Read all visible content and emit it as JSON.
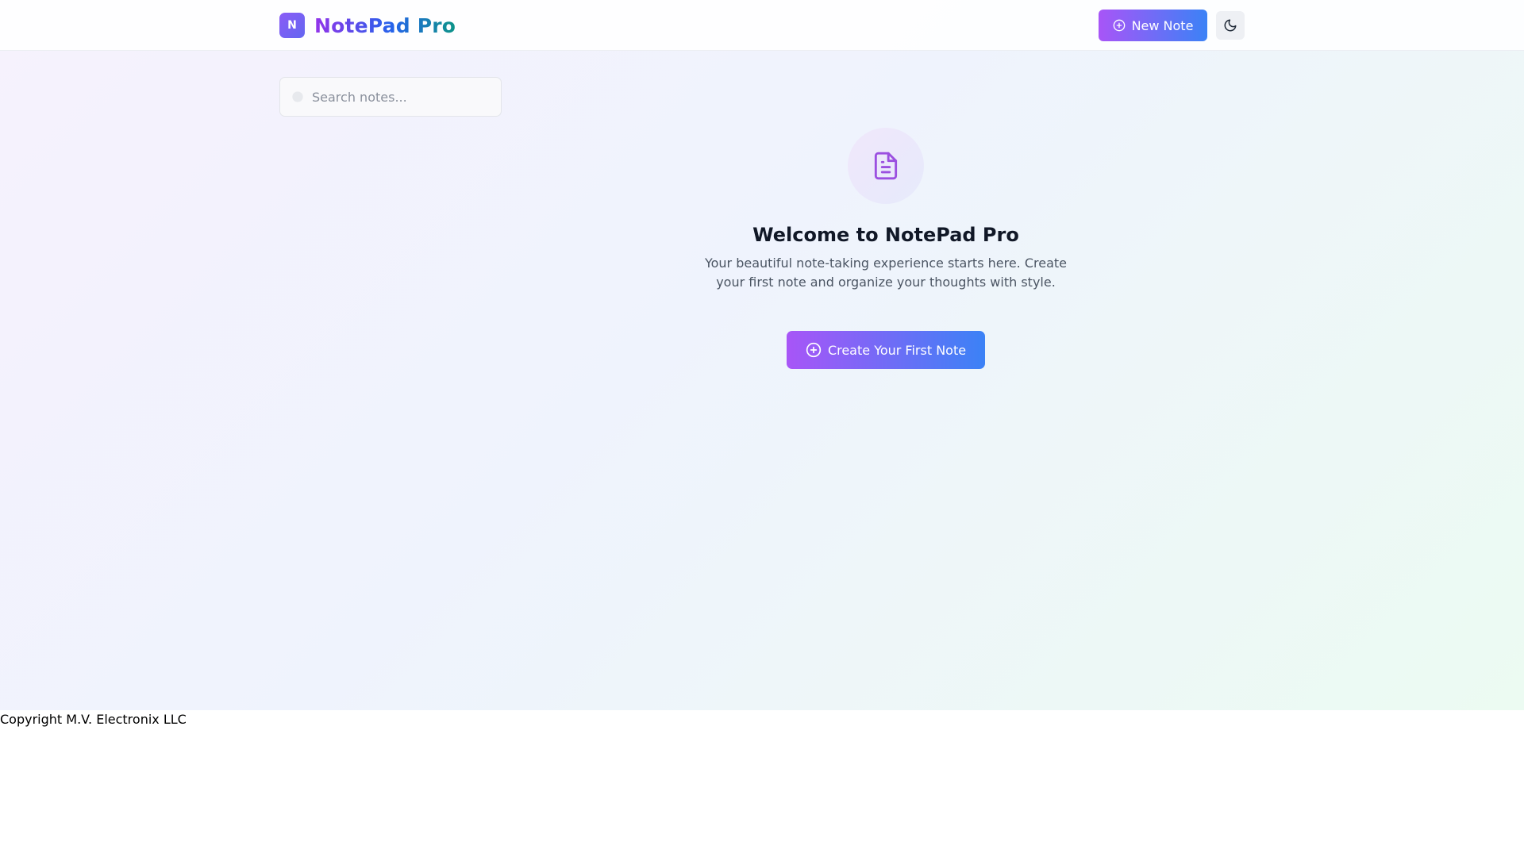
{
  "header": {
    "logo_letter": "N",
    "app_name": "NotePad Pro",
    "new_note_label": "New Note",
    "new_note_icon": "plus-circle-icon",
    "theme_toggle_icon": "moon-icon"
  },
  "search": {
    "placeholder": "Search notes...",
    "value": "",
    "icon": "search-icon"
  },
  "empty_state": {
    "icon": "file-text-icon",
    "title": "Welcome to NotePad Pro",
    "description": "Your beautiful note-taking experience starts here. Create your first note and organize your thoughts with style.",
    "cta_label": "Create Your First Note",
    "cta_icon": "plus-circle-icon"
  },
  "footer": {
    "copyright": "Copyright M.V. Electronix LLC"
  },
  "colors": {
    "accent_start": "#a855f7",
    "accent_end": "#3b82f6",
    "brand_gradient": [
      "#9333ea",
      "#2563eb",
      "#0d9488"
    ],
    "icon_purple": "#9b4fe0"
  }
}
